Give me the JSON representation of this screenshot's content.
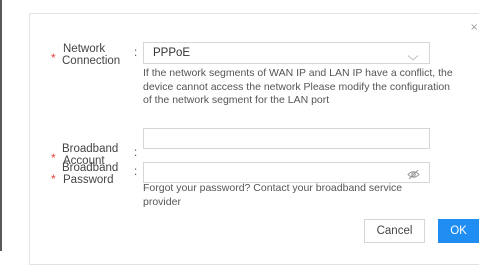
{
  "dialog": {
    "close_glyph": "×"
  },
  "form": {
    "network_connection": {
      "label_line1": "Network",
      "label_line2": "Connection",
      "value": "PPPoE",
      "hint": "If the network segments of WAN IP and LAN IP have a conflict, the device cannot access the network Please modify the configuration of the network segment for the LAN port"
    },
    "broadband_account": {
      "label_line1": "Broadband",
      "label_line2": "Account",
      "value": ""
    },
    "broadband_password": {
      "label_line1": "Broadband",
      "label_line2": "Password",
      "value": "",
      "hint": "Forgot your password? Contact your broadband service provider"
    },
    "required_mark": "*",
    "colon": ":"
  },
  "buttons": {
    "cancel": "Cancel",
    "ok": "OK"
  },
  "icons": {
    "select_arrow": "chevron-down-icon",
    "password_toggle": "eye-off-icon"
  },
  "colors": {
    "accent": "#1f8df2",
    "required": "#e6463b"
  }
}
